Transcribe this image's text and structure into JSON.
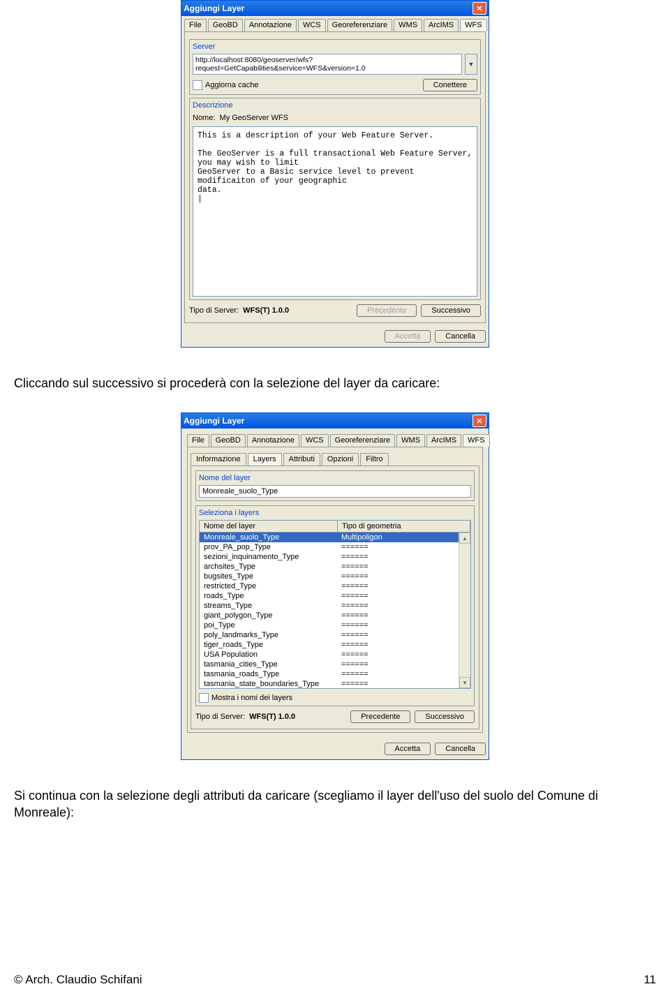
{
  "dlg1": {
    "title": "Aggiungi Layer",
    "tabs": [
      "File",
      "GeoBD",
      "Annotazione",
      "WCS",
      "Georeferenziare",
      "WMS",
      "ArcIMS",
      "WFS"
    ],
    "active_tab": "WFS",
    "server_label": "Server",
    "url": "http://localhost:8080/geoserver/wfs?request=GetCapabilities&service=WFS&version=1.0",
    "refresh_cache": "Aggiorna cache",
    "connect": "Conettere",
    "desc_label": "Descrizione",
    "name_label": "Nome:",
    "name_value": "My GeoServer WFS",
    "desc_text": "This is a description of your Web Feature Server.\n\nThe GeoServer is a full transactional Web Feature Server, you may wish to limit\nGeoServer to a Basic service level to prevent modificaiton of your geographic\ndata.\n|",
    "server_type_label": "Tipo di Server:",
    "server_type_value": "WFS(T) 1.0.0",
    "prev": "Precedente",
    "next": "Successivo",
    "accept": "Accetta",
    "cancel": "Cancella"
  },
  "para1": "Cliccando sul successivo si procederà con la selezione del layer da caricare:",
  "dlg2": {
    "title": "Aggiungi Layer",
    "tabs": [
      "File",
      "GeoBD",
      "Annotazione",
      "WCS",
      "Georeferenziare",
      "WMS",
      "ArcIMS",
      "WFS"
    ],
    "active_tab": "WFS",
    "subtabs": [
      "Informazione",
      "Layers",
      "Attributi",
      "Opzioni",
      "Filtro"
    ],
    "active_subtab": "Layers",
    "layer_name_label": "Nome del layer",
    "layer_name_value": "Monreale_suolo_Type",
    "select_label": "Seleziona i layers",
    "col1": "Nome del layer",
    "col2": "Tipo di geometria",
    "rows": [
      {
        "name": "Monreale_suolo_Type",
        "geom": "Multipoligon",
        "sel": true
      },
      {
        "name": "prov_PA_pop_Type",
        "geom": "======"
      },
      {
        "name": "sezioni_inquinamento_Type",
        "geom": "======"
      },
      {
        "name": "archsites_Type",
        "geom": "======"
      },
      {
        "name": "bugsites_Type",
        "geom": "======"
      },
      {
        "name": "restricted_Type",
        "geom": "======"
      },
      {
        "name": "roads_Type",
        "geom": "======"
      },
      {
        "name": "streams_Type",
        "geom": "======"
      },
      {
        "name": "giant_polygon_Type",
        "geom": "======"
      },
      {
        "name": "poi_Type",
        "geom": "======"
      },
      {
        "name": "poly_landmarks_Type",
        "geom": "======"
      },
      {
        "name": "tiger_roads_Type",
        "geom": "======"
      },
      {
        "name": "USA Population",
        "geom": "======"
      },
      {
        "name": "tasmania_cities_Type",
        "geom": "======"
      },
      {
        "name": "tasmania_roads_Type",
        "geom": "======"
      },
      {
        "name": "tasmania_state_boundaries_Type",
        "geom": "======"
      }
    ],
    "show_names": "Mostra i nomi dei layers",
    "server_type_label": "Tipo di Server:",
    "server_type_value": "WFS(T) 1.0.0",
    "prev": "Precedente",
    "next": "Successivo",
    "accept": "Accetta",
    "cancel": "Cancella"
  },
  "para2": "Si continua con la selezione degli attributi da caricare (scegliamo il layer dell'uso del suolo del Comune di Monreale):",
  "footer_left": "© Arch. Claudio Schifani",
  "footer_right": "11"
}
